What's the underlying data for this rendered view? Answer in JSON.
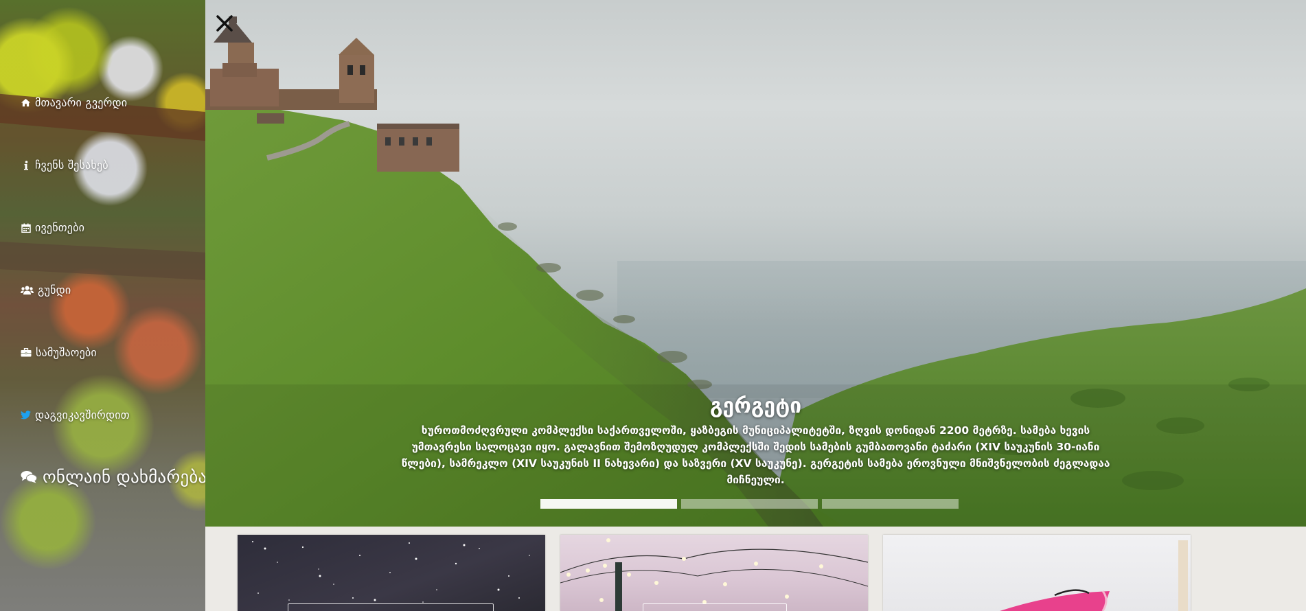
{
  "sidebar": {
    "items": [
      {
        "icon": "home-icon",
        "label": "მთავარი გვერდი"
      },
      {
        "icon": "info-icon",
        "label": "ჩვენს შესახებ"
      },
      {
        "icon": "calendar-icon",
        "label": "ივენთები"
      },
      {
        "icon": "users-icon",
        "label": "გუნდი"
      },
      {
        "icon": "briefcase-icon",
        "label": "სამუშაოები"
      },
      {
        "icon": "twitter-icon",
        "label": "დაგვიკავშირდით"
      },
      {
        "icon": "comments-icon",
        "label": "ონლაინ დახმარება"
      }
    ]
  },
  "hero": {
    "close_icon": "close-icon",
    "title": "გერგეტი",
    "description": "ხუროთმოძღვრული კომპლექსი საქართველოში, ყაზბეგის მუნიციპალიტეტში, ზღვის დონიდან 2200 მეტრზე. სამება ხევის უმთავრესი სალოცავი იყო. გალავნით შემოზღუდულ კომპლექსში შედის სამების გუმბათოვანი ტაძარი (XIV საუკუნის 30-იანი წლები), სამრეკლო (XIV საუკუნის II ნახევარი) და საზვერი (XV საუკუნე). გერგეტის სამება ეროვნული მნიშვნელობის ძეგლადაა მიჩნეული.",
    "slide_count": 3,
    "active_slide": 1
  },
  "colors": {
    "twitter": "#1da1f2",
    "hero_text": "#ffffff",
    "cards_bg": "#eceae6"
  }
}
